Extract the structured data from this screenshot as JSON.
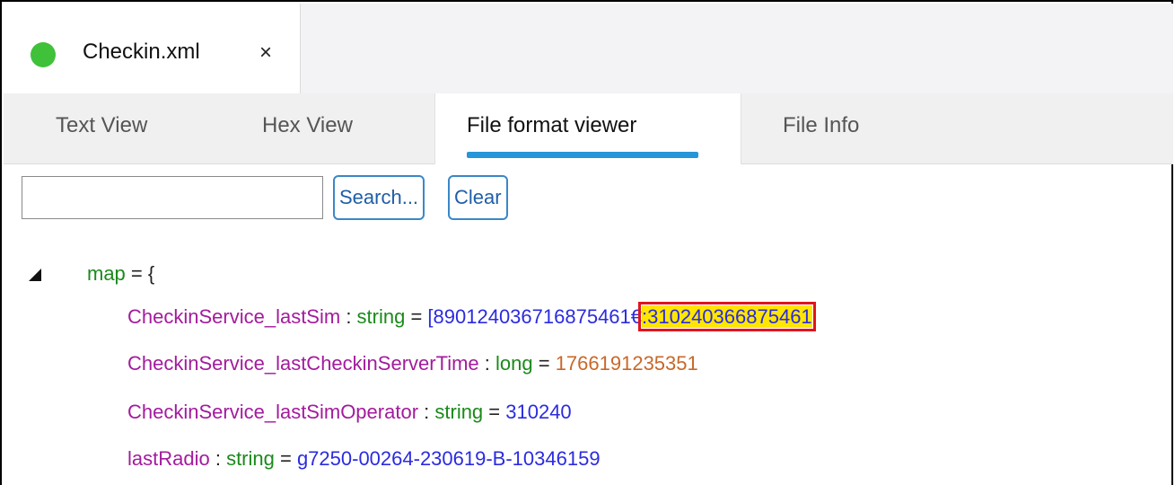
{
  "file_tab": {
    "title": "Checkin.xml",
    "close_glyph": "×",
    "status_color": "#3fc13a"
  },
  "view_tabs": [
    {
      "label": "Text View",
      "active": false
    },
    {
      "label": "Hex View",
      "active": false
    },
    {
      "label": "File format viewer",
      "active": true
    },
    {
      "label": "File Info",
      "active": false
    }
  ],
  "search": {
    "value": "",
    "placeholder": "",
    "search_label": "Search...",
    "clear_label": "Clear"
  },
  "tree": {
    "toggle_icon": "collapse-triangle-icon",
    "root": {
      "name": "map",
      "op": "= {"
    },
    "entries": [
      {
        "key": "CheckinService_lastSim",
        "sep": " : ",
        "type": "string",
        "eq": " = ",
        "value": "[890124036716875461€",
        "value_highlight": ":310240366875461"
      },
      {
        "key": "CheckinService_lastCheckinServerTime",
        "sep": " : ",
        "type": "long",
        "eq": " = ",
        "value": "1766191235351"
      },
      {
        "key": "CheckinService_lastSimOperator",
        "sep": " : ",
        "type": "string",
        "eq": " = ",
        "value": "310240"
      },
      {
        "key": "lastRadio",
        "sep": " : ",
        "type": "string",
        "eq": " = ",
        "value": "g7250-00264-230619-B-10346159"
      }
    ]
  },
  "colors": {
    "accent_underline": "#2596d8",
    "highlight_fill": "#ffe600",
    "highlight_border": "#e0141c"
  }
}
